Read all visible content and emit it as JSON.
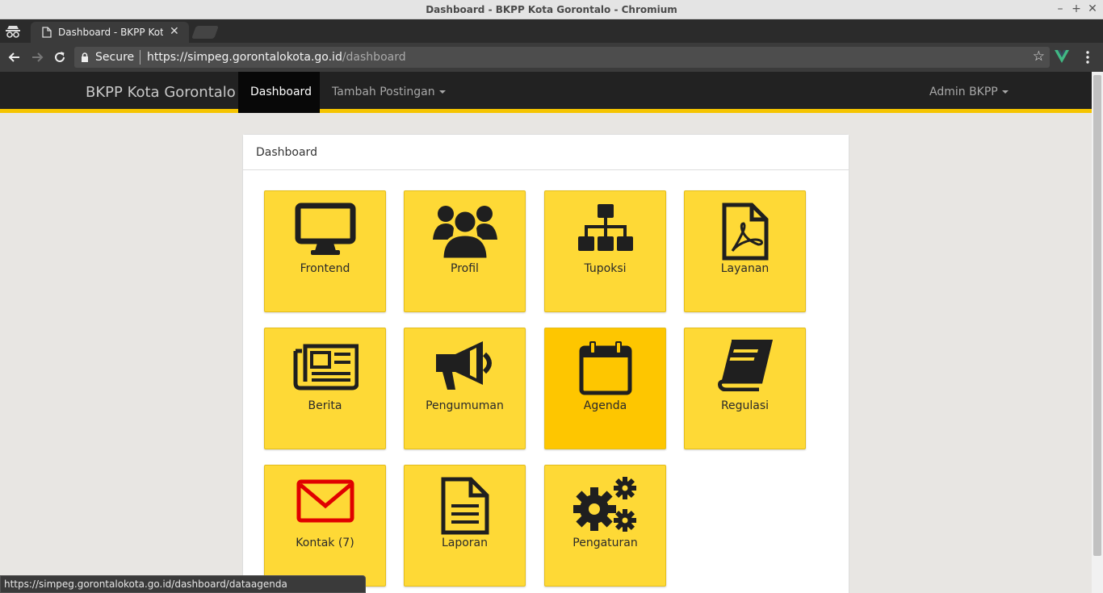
{
  "window": {
    "title": "Dashboard - BKPP Kota Gorontalo - Chromium"
  },
  "browser": {
    "tab_title": "Dashboard - BKPP Kota Gorontalo",
    "secure_label": "Secure",
    "url_host": "https://simpeg.gorontalokota.go.id",
    "url_path": "/dashboard",
    "status_url": "https://simpeg.gorontalokota.go.id/dashboard/dataagenda"
  },
  "navbar": {
    "brand": "BKPP Kota Gorontalo",
    "items": [
      {
        "label": "Dashboard",
        "active": true
      },
      {
        "label": "Tambah Postingan",
        "dropdown": true
      }
    ],
    "user": "Admin BKPP"
  },
  "panel": {
    "heading": "Dashboard",
    "tiles": [
      {
        "label": "Frontend",
        "icon": "desktop-icon"
      },
      {
        "label": "Profil",
        "icon": "users-icon"
      },
      {
        "label": "Tupoksi",
        "icon": "sitemap-icon"
      },
      {
        "label": "Layanan",
        "icon": "file-pdf-icon"
      },
      {
        "label": "Berita",
        "icon": "newspaper-icon"
      },
      {
        "label": "Pengumuman",
        "icon": "bullhorn-icon"
      },
      {
        "label": "Agenda",
        "icon": "calendar-icon",
        "active": true
      },
      {
        "label": "Regulasi",
        "icon": "book-icon"
      },
      {
        "label": "Kontak (7)",
        "icon": "envelope-icon"
      },
      {
        "label": "Laporan",
        "icon": "file-text-icon"
      },
      {
        "label": "Pengaturan",
        "icon": "gears-icon"
      }
    ]
  },
  "colors": {
    "tile": "#fed936",
    "tile_active": "#fec600",
    "navbar": "#222222",
    "accent": "#f5c400",
    "envelope": "#e00000"
  }
}
